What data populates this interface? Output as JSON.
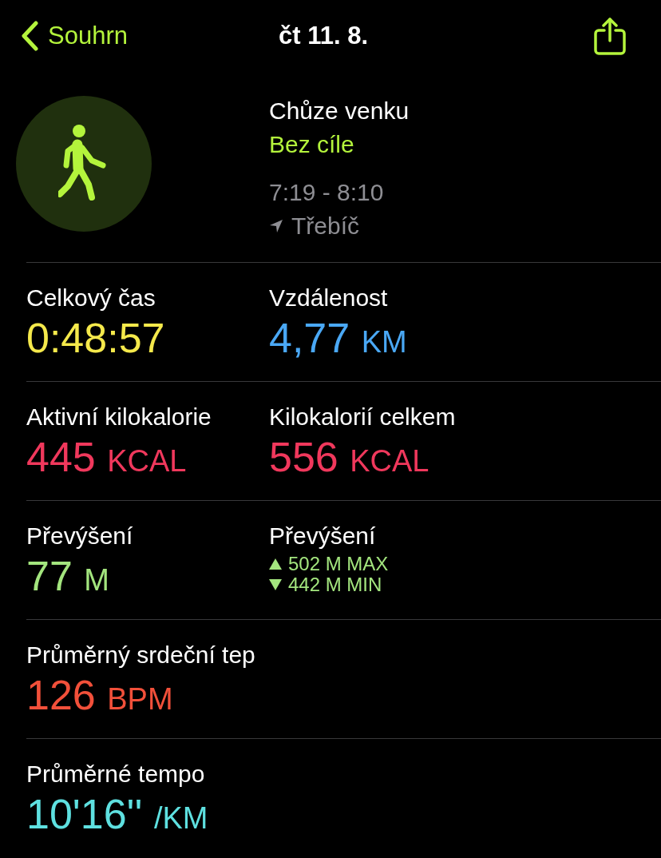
{
  "nav": {
    "back_label": "Souhrn",
    "title": "čt 11. 8."
  },
  "workout": {
    "name": "Chůze venku",
    "goal": "Bez cíle",
    "time": "7:19 - 8:10",
    "location": "Třebíč"
  },
  "metric_rows": [
    {
      "cells": [
        {
          "kind": "value",
          "label": "Celkový čas",
          "value": "0:48:57",
          "color": "#f5e94b"
        },
        {
          "kind": "value",
          "label": "Vzdálenost",
          "value": "4,77",
          "unit": "KM",
          "color": "#4aa8f5"
        }
      ]
    },
    {
      "cells": [
        {
          "kind": "value",
          "label": "Aktivní kilokalorie",
          "value": "445",
          "unit": "KCAL",
          "color": "#f0385c"
        },
        {
          "kind": "value",
          "label": "Kilokalorií celkem",
          "value": "556",
          "unit": "KCAL",
          "color": "#f0385c"
        }
      ]
    },
    {
      "cells": [
        {
          "kind": "value",
          "label": "Převýšení",
          "value": "77",
          "unit": "M",
          "color": "#a3e57e"
        },
        {
          "kind": "range",
          "label": "Převýšení",
          "color": "#a3e57e",
          "lines": [
            {
              "kind": "up",
              "text": "502 M MAX"
            },
            {
              "kind": "down",
              "text": "442 M MIN"
            }
          ]
        }
      ]
    },
    {
      "cells": [
        {
          "kind": "value",
          "label": "Průměrný srdeční tep",
          "value": "126",
          "unit": "BPM",
          "color": "#f2503a"
        }
      ]
    },
    {
      "cells": [
        {
          "kind": "value",
          "label": "Průměrné tempo",
          "value": "10'16''",
          "unit": "/KM",
          "color": "#5ee0e0"
        }
      ]
    }
  ]
}
